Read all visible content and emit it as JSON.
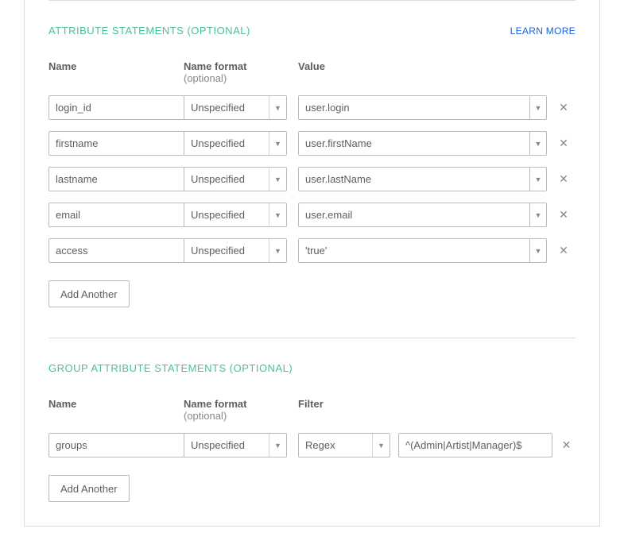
{
  "attribute_section": {
    "title": "ATTRIBUTE STATEMENTS (OPTIONAL)",
    "learn_more": "LEARN MORE",
    "headers": {
      "name": "Name",
      "format": "Name format",
      "format_optional": "(optional)",
      "value": "Value"
    },
    "rows": [
      {
        "name": "login_id",
        "format": "Unspecified",
        "value": "user.login"
      },
      {
        "name": "firstname",
        "format": "Unspecified",
        "value": "user.firstName"
      },
      {
        "name": "lastname",
        "format": "Unspecified",
        "value": "user.lastName"
      },
      {
        "name": "email",
        "format": "Unspecified",
        "value": "user.email"
      },
      {
        "name": "access",
        "format": "Unspecified",
        "value": "'true'"
      }
    ],
    "add_button": "Add Another"
  },
  "group_section": {
    "title": "GROUP ATTRIBUTE STATEMENTS (OPTIONAL)",
    "headers": {
      "name": "Name",
      "format": "Name format",
      "format_optional": "(optional)",
      "filter": "Filter"
    },
    "rows": [
      {
        "name": "groups",
        "format": "Unspecified",
        "filter_type": "Regex",
        "filter_value": "^(Admin|Artist|Manager)$"
      }
    ],
    "add_button": "Add Another"
  }
}
